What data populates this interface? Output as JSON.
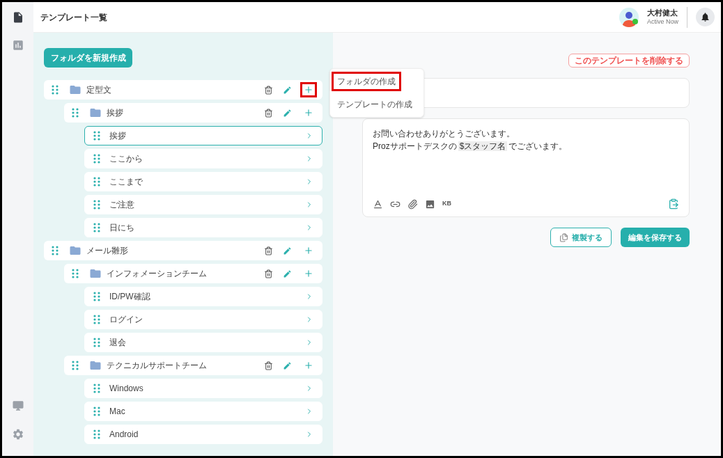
{
  "sidebar": {
    "items": [
      {
        "kind": "document",
        "selected": true
      },
      {
        "kind": "chart",
        "selected": false
      },
      {
        "kind": "monitor",
        "selected": false
      },
      {
        "kind": "settings",
        "selected": false
      }
    ]
  },
  "header": {
    "title": "テンプレート一覧",
    "user": {
      "name": "大村健太",
      "status": "Active Now",
      "online": true
    }
  },
  "folder_button": "フォルダを新規作成",
  "tree": [
    {
      "kind": "folder",
      "label": "定型文",
      "plus_highlighted": true,
      "children": [
        {
          "kind": "folder",
          "label": "挨拶",
          "plus_highlighted": false,
          "children": [
            {
              "kind": "template",
              "label": "挨拶",
              "selected": true
            },
            {
              "kind": "template",
              "label": "ここから",
              "selected": false
            },
            {
              "kind": "template",
              "label": "ここまで",
              "selected": false
            },
            {
              "kind": "template",
              "label": "ご注意",
              "selected": false
            },
            {
              "kind": "template",
              "label": "日にち",
              "selected": false
            }
          ]
        }
      ]
    },
    {
      "kind": "folder",
      "label": "メール雛形",
      "plus_highlighted": false,
      "children": [
        {
          "kind": "folder",
          "label": "インフォメーションチーム",
          "plus_highlighted": false,
          "children": [
            {
              "kind": "template",
              "label": "ID/PW確認",
              "selected": false
            },
            {
              "kind": "template",
              "label": "ログイン",
              "selected": false
            },
            {
              "kind": "template",
              "label": "退会",
              "selected": false
            }
          ]
        },
        {
          "kind": "folder",
          "label": "テクニカルサポートチーム",
          "plus_highlighted": false,
          "children": [
            {
              "kind": "template",
              "label": "Windows",
              "selected": false
            },
            {
              "kind": "template",
              "label": "Mac",
              "selected": false
            },
            {
              "kind": "template",
              "label": "Android",
              "selected": false
            }
          ]
        }
      ]
    }
  ],
  "popup_menu": [
    {
      "label": "フォルダの作成",
      "highlighted": true
    },
    {
      "label": "テンプレートの作成",
      "highlighted": false
    }
  ],
  "editor": {
    "delete_button": "このテンプレートを削除する",
    "body": [
      {
        "text": "お問い合わせありがとうございます。"
      },
      {
        "before": "Prozサポートデスクの",
        "variable": "$スタッフ名",
        "after": "でございます。"
      }
    ],
    "toolbar": [
      {
        "kind": "text-color"
      },
      {
        "kind": "link"
      },
      {
        "kind": "attach"
      },
      {
        "kind": "image"
      },
      {
        "kind": "label",
        "text": "KB"
      }
    ],
    "copy_button": "複製する",
    "save_button": "編集を保存する"
  }
}
